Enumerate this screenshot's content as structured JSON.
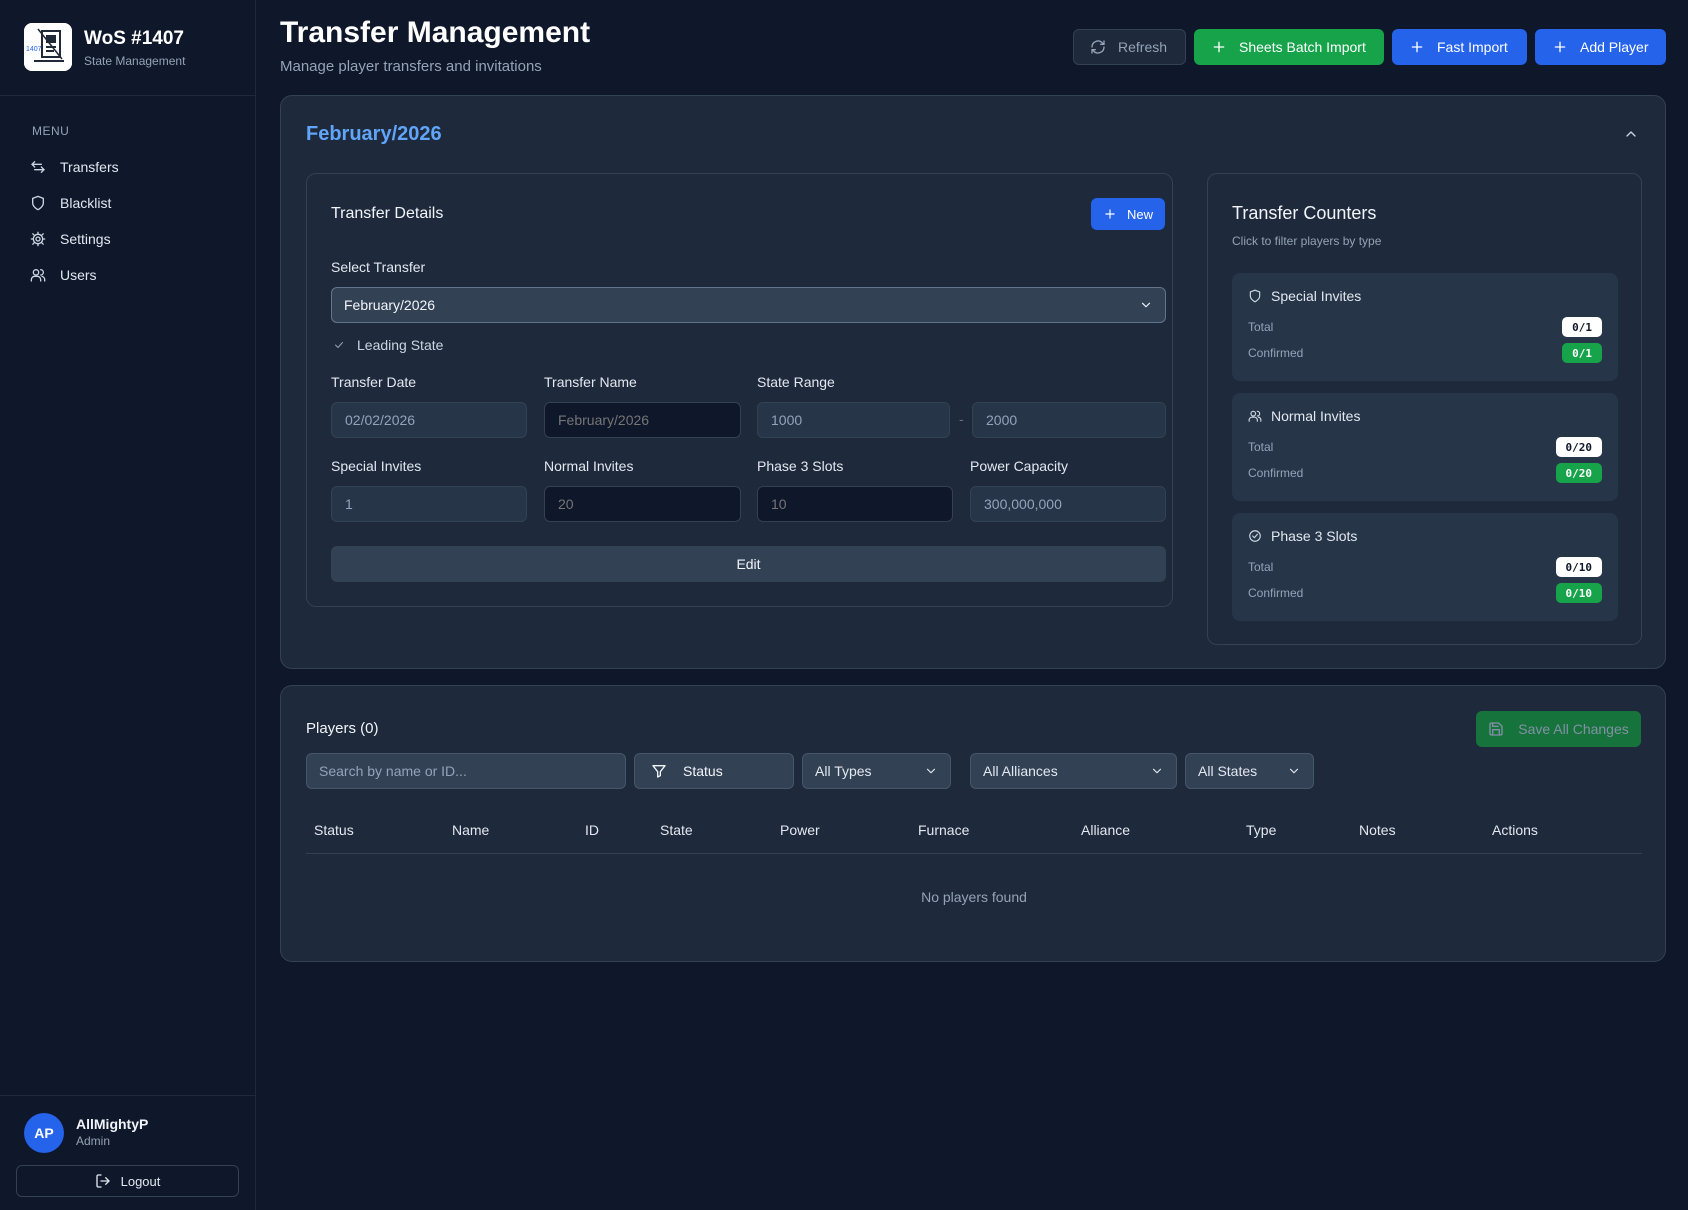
{
  "sidebar": {
    "brand_title": "WoS #1407",
    "brand_subtitle": "State Management",
    "logo_text": "1407",
    "menu_label": "MENU",
    "items": [
      {
        "label": "Transfers",
        "icon": "arrows-exchange-icon"
      },
      {
        "label": "Blacklist",
        "icon": "shield-icon"
      },
      {
        "label": "Settings",
        "icon": "gear-icon"
      },
      {
        "label": "Users",
        "icon": "users-icon"
      }
    ],
    "user": {
      "initials": "AP",
      "name": "AllMightyP",
      "role": "Admin"
    },
    "logout_label": "Logout"
  },
  "header": {
    "title": "Transfer Management",
    "subtitle": "Manage player transfers and invitations",
    "refresh_label": "Refresh",
    "sheets_import_label": "Sheets Batch Import",
    "fast_import_label": "Fast Import",
    "add_player_label": "Add Player"
  },
  "transfer": {
    "heading": "February/2026",
    "details": {
      "title": "Transfer Details",
      "new_label": "New",
      "select_label": "Select Transfer",
      "selected_value": "February/2026",
      "leading_state_label": "Leading State",
      "date_label": "Transfer Date",
      "date_value": "02/02/2026",
      "name_label": "Transfer Name",
      "name_placeholder": "February/2026",
      "range_label": "State Range",
      "range_min": "1000",
      "range_max": "2000",
      "range_separator": "-",
      "special_label": "Special Invites",
      "special_value": "1",
      "normal_label": "Normal Invites",
      "normal_placeholder": "20",
      "phase3_label": "Phase 3 Slots",
      "phase3_placeholder": "10",
      "power_label": "Power Capacity",
      "power_value": "300,000,000",
      "edit_label": "Edit"
    },
    "counters": {
      "title": "Transfer Counters",
      "subtitle": "Click to filter players by type",
      "items": [
        {
          "label": "Special Invites",
          "icon": "shield-icon",
          "total_label": "Total",
          "total": "0/1",
          "confirmed_label": "Confirmed",
          "confirmed": "0/1"
        },
        {
          "label": "Normal Invites",
          "icon": "users-icon",
          "total_label": "Total",
          "total": "0/20",
          "confirmed_label": "Confirmed",
          "confirmed": "0/20"
        },
        {
          "label": "Phase 3 Slots",
          "icon": "check-circle-icon",
          "total_label": "Total",
          "total": "0/10",
          "confirmed_label": "Confirmed",
          "confirmed": "0/10"
        }
      ]
    }
  },
  "players": {
    "title": "Players (0)",
    "save_label": "Save All Changes",
    "search_placeholder": "Search by name or ID...",
    "status_filter_label": "Status",
    "types_dropdown": "All Types",
    "alliances_dropdown": "All Alliances",
    "states_dropdown": "All States",
    "columns": [
      "Status",
      "Name",
      "ID",
      "State",
      "Power",
      "Furnace",
      "Alliance",
      "Type",
      "Notes",
      "Actions"
    ],
    "empty_message": "No players found"
  },
  "colors": {
    "background": "#0f172a",
    "panel": "#1e293b",
    "accent_blue": "#2563eb",
    "accent_green": "#16a34a",
    "heading_blue": "#60a5fa"
  }
}
